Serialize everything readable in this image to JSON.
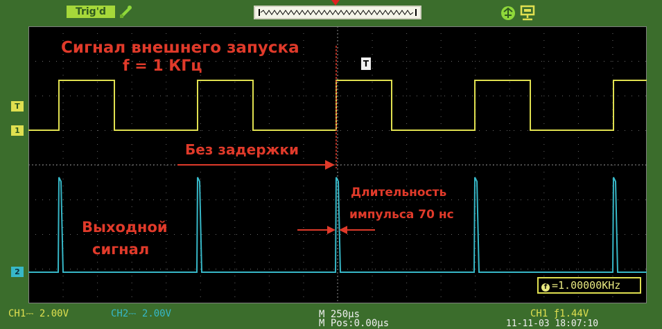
{
  "status": {
    "trigger_state": "Trig'd",
    "icons": [
      "usb-icon",
      "network-icon",
      "display-icon"
    ]
  },
  "colors": {
    "background": "#3b6d2c",
    "screen": "#000000",
    "ch1": "#e0e050",
    "ch2": "#37b8c8",
    "annotation": "#e03a2a",
    "trigger_marker": "#e02020"
  },
  "screen_markers": {
    "trigger": "T",
    "ch1": "1",
    "ch2": "2",
    "trigger_time": "T"
  },
  "annotations": {
    "title_line1": "Сигнал внешнего запуска",
    "title_line2": "f = 1 КГц",
    "no_delay": "Без задержки",
    "duration_line1": "Длительность",
    "duration_line2": "импульса 70 нс",
    "output_line1": "Выходной",
    "output_line2": "сигнал"
  },
  "freq_counter": {
    "value": "=1.00000KHz"
  },
  "statusbar": {
    "ch1_scale": "CH1⎓ 2.00V",
    "ch2_scale": "CH2⎓ 2.00V",
    "timebase": "M 250µs",
    "time_position": "M Pos:0.00µs",
    "trigger": "CH1 ƒ1.44V",
    "datetime": "11-11-03 18:07:10"
  }
}
